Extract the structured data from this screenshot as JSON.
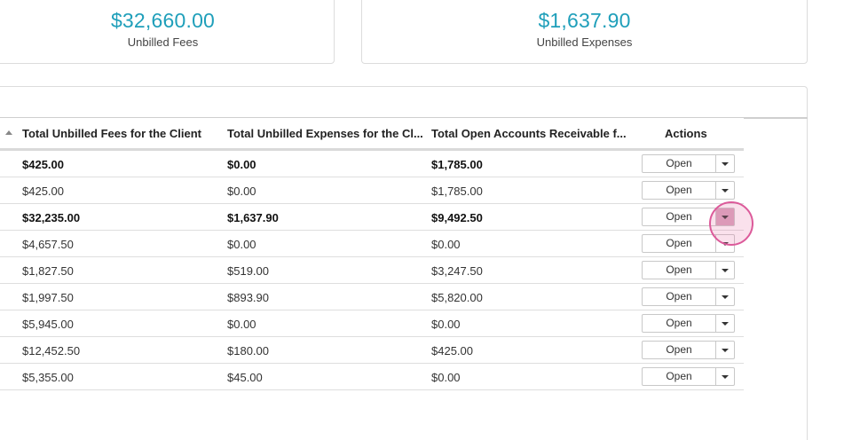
{
  "summary": {
    "unbilled_fees": {
      "amount": "$32,660.00",
      "label": "Unbilled Fees"
    },
    "unbilled_expenses": {
      "amount": "$1,637.90",
      "label": "Unbilled Expenses"
    }
  },
  "table": {
    "columns": [
      "Total Unbilled Fees for the Client",
      "Total Unbilled Expenses for the Cl...",
      "Total Open Accounts Receivable f...",
      "Actions"
    ],
    "sort_icon": "sort-ascending-icon",
    "action_label": "Open",
    "dropdown_icon": "caret-down-icon",
    "rows": [
      {
        "fees": "$425.00",
        "expenses": "$0.00",
        "receivable": "$1,785.00",
        "bold": true
      },
      {
        "fees": "$425.00",
        "expenses": "$0.00",
        "receivable": "$1,785.00",
        "bold": false
      },
      {
        "fees": "$32,235.00",
        "expenses": "$1,637.90",
        "receivable": "$9,492.50",
        "bold": true
      },
      {
        "fees": "$4,657.50",
        "expenses": "$0.00",
        "receivable": "$0.00",
        "bold": false
      },
      {
        "fees": "$1,827.50",
        "expenses": "$519.00",
        "receivable": "$3,247.50",
        "bold": false
      },
      {
        "fees": "$1,997.50",
        "expenses": "$893.90",
        "receivable": "$5,820.00",
        "bold": false
      },
      {
        "fees": "$5,945.00",
        "expenses": "$0.00",
        "receivable": "$0.00",
        "bold": false
      },
      {
        "fees": "$12,452.50",
        "expenses": "$180.00",
        "receivable": "$425.00",
        "bold": false
      },
      {
        "fees": "$5,355.00",
        "expenses": "$45.00",
        "receivable": "$0.00",
        "bold": false
      }
    ]
  },
  "colors": {
    "summary_accent": "#1f9fba",
    "active_dropdown": "#d9a5bd",
    "click_indicator": "#dc5a9a"
  }
}
